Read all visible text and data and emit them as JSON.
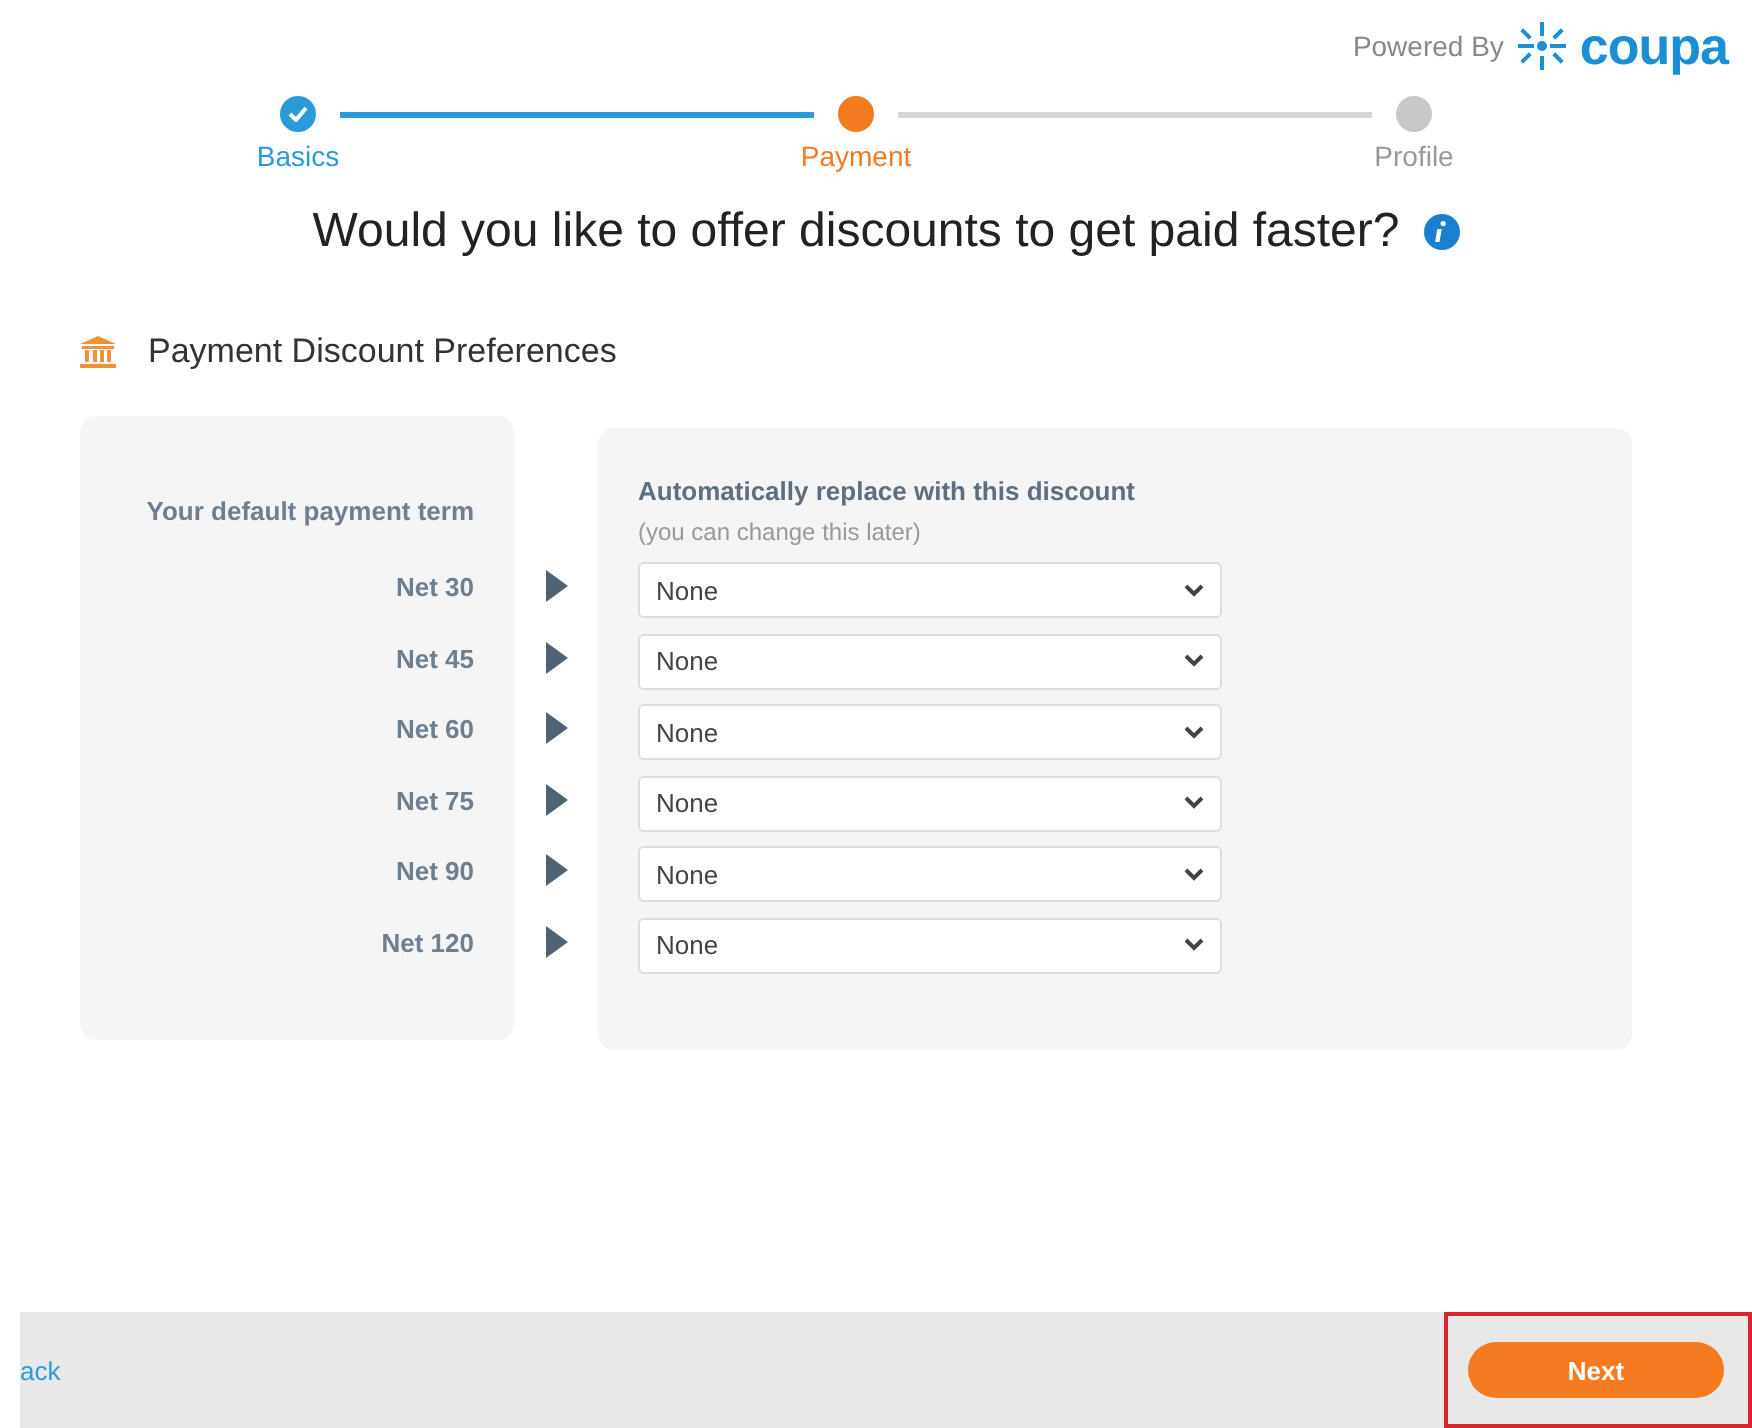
{
  "branding": {
    "prefix": "Powered By",
    "logo_text": "coupa"
  },
  "steps": [
    {
      "label": "Basics",
      "completed": true,
      "selected": false
    },
    {
      "label": "Payment",
      "completed": false,
      "selected": true
    },
    {
      "label": "Profile",
      "completed": false,
      "selected": false
    }
  ],
  "heading": "Would you like to offer discounts to get paid faster?",
  "section_title": "Payment Discount Preferences",
  "terms_panel": {
    "title": "Your default payment term"
  },
  "discount_panel": {
    "title": "Automatically replace with this discount",
    "note": "(you can change this later)"
  },
  "rows": [
    {
      "term": "Net 30",
      "discount": "None"
    },
    {
      "term": "Net 45",
      "discount": "None"
    },
    {
      "term": "Net 60",
      "discount": "None"
    },
    {
      "term": "Net 75",
      "discount": "None"
    },
    {
      "term": "Net 90",
      "discount": "None"
    },
    {
      "term": "Net 120",
      "discount": "None"
    }
  ],
  "footer": {
    "back": "ack",
    "next": "Next",
    "next_highlighted": true
  }
}
